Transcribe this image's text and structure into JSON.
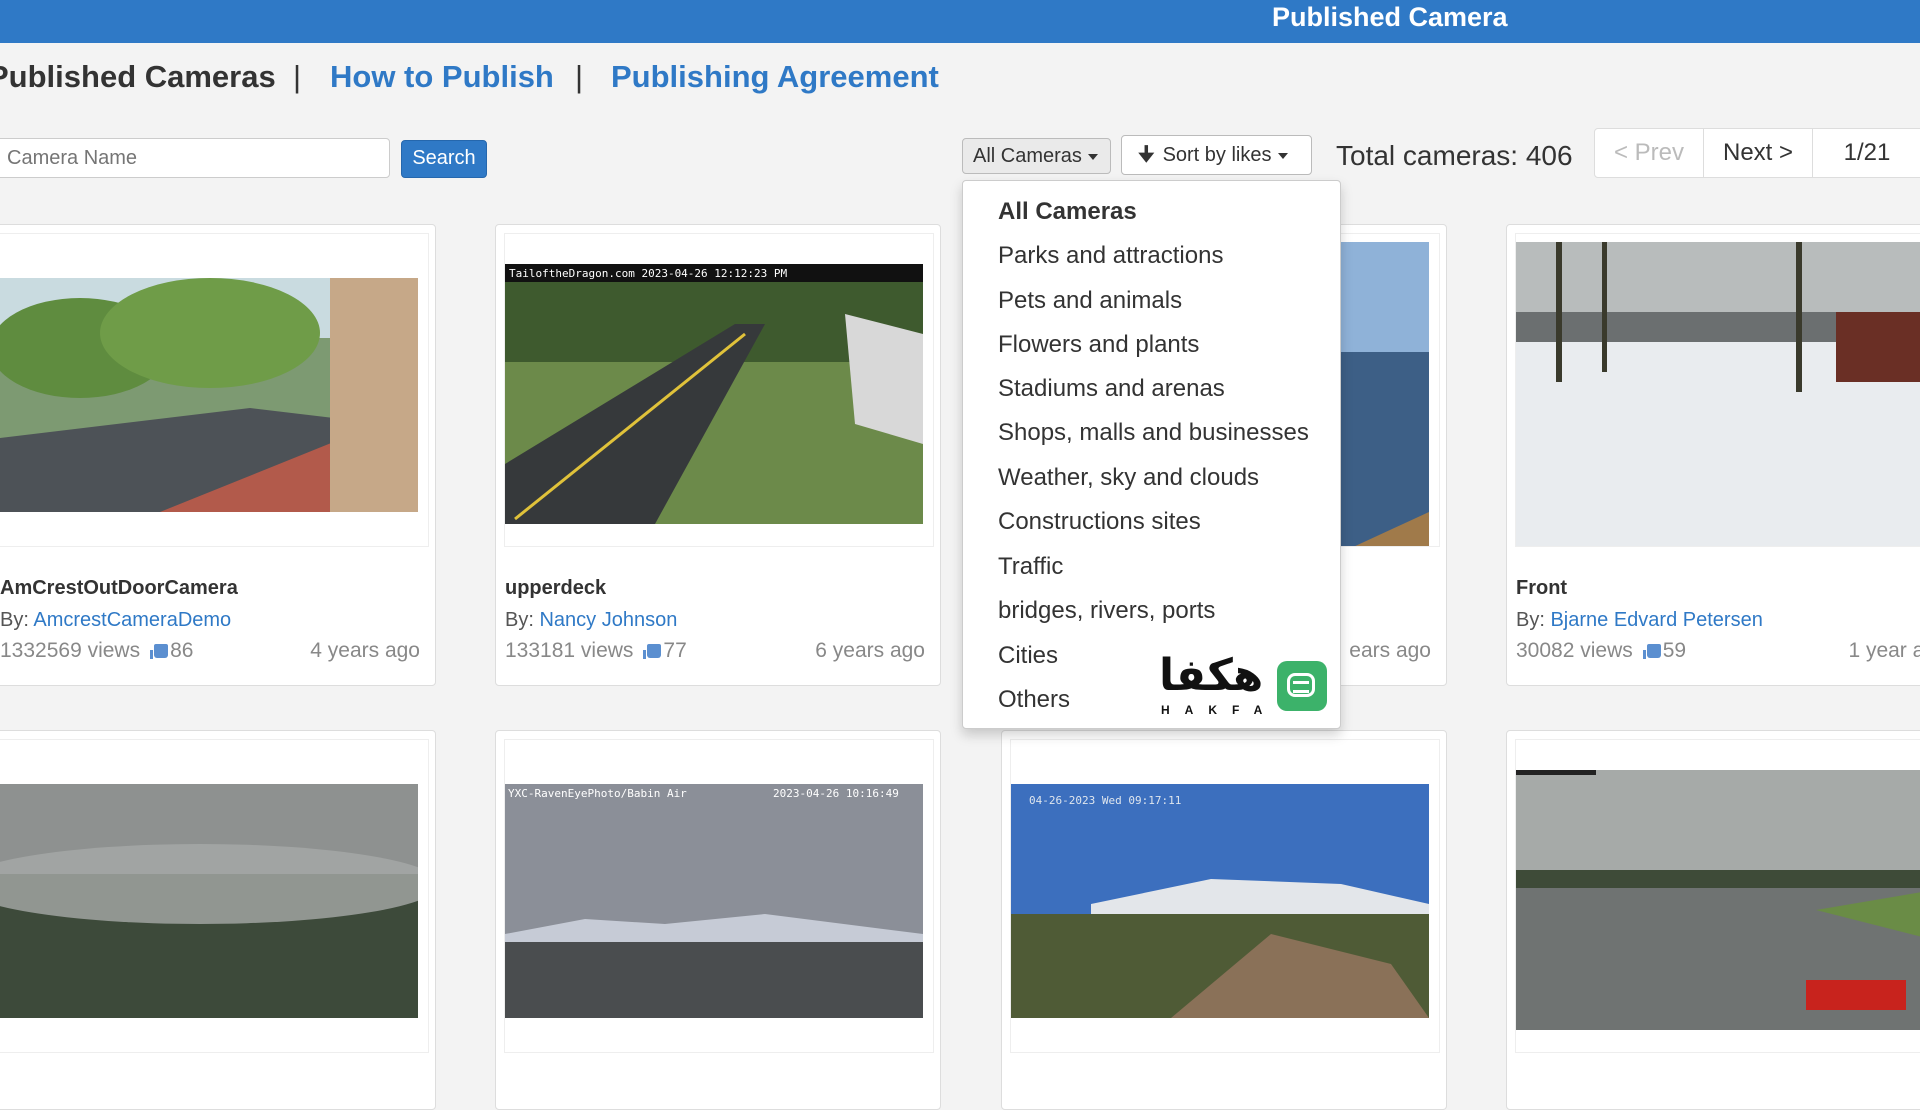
{
  "header": {
    "title": "Published Camera"
  },
  "nav": {
    "published": "Published Cameras",
    "separator": "|",
    "how_to_publish": "How to Publish",
    "agreement": "Publishing Agreement"
  },
  "toolbar": {
    "search_placeholder": "Camera Name",
    "search_button": "Search",
    "filter_label": "All Cameras",
    "sort_label": "Sort by likes",
    "total_text": "Total cameras: 406"
  },
  "pager": {
    "prev": "< Prev",
    "next": "Next >",
    "page": "1/21"
  },
  "dropdown": {
    "items": [
      "All Cameras",
      "Parks and attractions",
      "Pets and animals",
      "Flowers and plants",
      "Stadiums and arenas",
      "Shops, malls and businesses",
      "Weather, sky and clouds",
      "Constructions sites",
      "Traffic",
      "bridges, rivers, ports",
      "Cities",
      "Others"
    ],
    "selected": "All Cameras"
  },
  "watermark": {
    "arabic": "هكفا",
    "latin": "HAKFA"
  },
  "cameras": [
    {
      "name": "AmCrestOutDoorCamera",
      "by": "By:",
      "author": "AmcrestCameraDemo",
      "views": "1332569 views",
      "likes": "86",
      "ago": "4 years ago",
      "overlay": ""
    },
    {
      "name": "upperdeck",
      "by": "By:",
      "author": "Nancy Johnson",
      "views": "133181 views",
      "likes": "77",
      "ago": "6 years ago",
      "overlay": "TailoftheDragon.com 2023-04-26 12:12:23 PM"
    },
    {
      "ago": "ears ago"
    },
    {
      "name": "Front",
      "by": "By:",
      "author": "Bjarne Edvard Petersen",
      "views": "30082 views",
      "likes": "59",
      "ago": "1 year ag"
    },
    {
      "overlay": ""
    },
    {
      "overlay": "YXC-RavenEyePhoto/Babin Air",
      "overlay_time": "2023-04-26 10:16:49"
    },
    {
      "overlay": "04-26-2023 Wed 09:17:11"
    },
    {
      "overlay": ""
    }
  ],
  "colors": {
    "primary": "#2f79c6",
    "background": "#f3f3f3",
    "badge_green": "#3cb26a"
  },
  "icons": {
    "sort": "arrow-down-icon",
    "like": "thumbs-up-icon",
    "caret": "caret-down-icon"
  }
}
